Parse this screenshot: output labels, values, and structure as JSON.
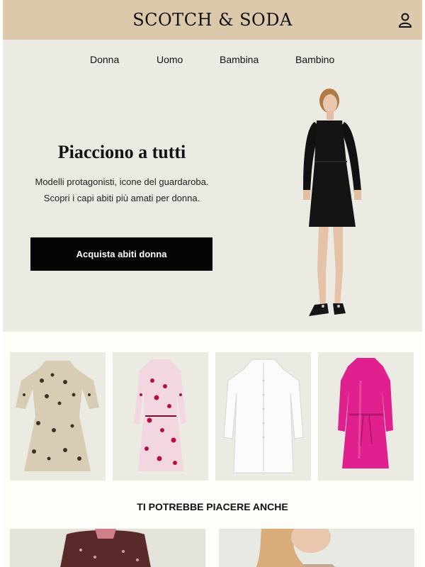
{
  "header": {
    "logo": "SCOTCH & SODA",
    "account_icon": "user-icon"
  },
  "nav": {
    "items": [
      "Donna",
      "Uomo",
      "Bambina",
      "Bambino"
    ]
  },
  "hero": {
    "title": "Piacciono a tutti",
    "text": "Modelli protagonisti, icone del guardaroba. Scopri i capi abiti più amati per donna.",
    "cta_label": "Acquista abiti donna"
  },
  "products": [
    {
      "icon": "leopard-print-dress-image"
    },
    {
      "icon": "pink-print-dress-image"
    },
    {
      "icon": "white-shirt-dress-image"
    },
    {
      "icon": "fuchsia-satin-dress-image"
    }
  ],
  "recommendations": {
    "title": "TI POTREBBE PIACERE ANCHE"
  },
  "colors": {
    "header_bg": "#dcc8ab",
    "hero_bg": "#ebebe4",
    "cta_bg": "#050505",
    "fuchsia": "#e0208f"
  }
}
